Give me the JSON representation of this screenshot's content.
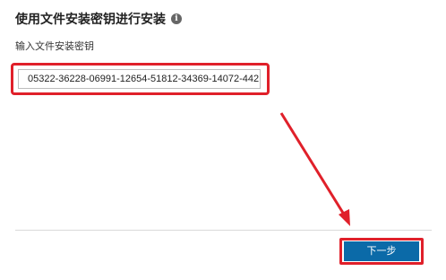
{
  "title": "使用文件安装密钥进行安装",
  "info_icon": "info-icon",
  "field": {
    "label": "输入文件安装密钥",
    "value": "05322-36228-06991-12654-51812-34369-14072-442"
  },
  "next_button_label": "下一步",
  "colors": {
    "annotation": "#e0202a",
    "button": "#0b6aa8"
  }
}
